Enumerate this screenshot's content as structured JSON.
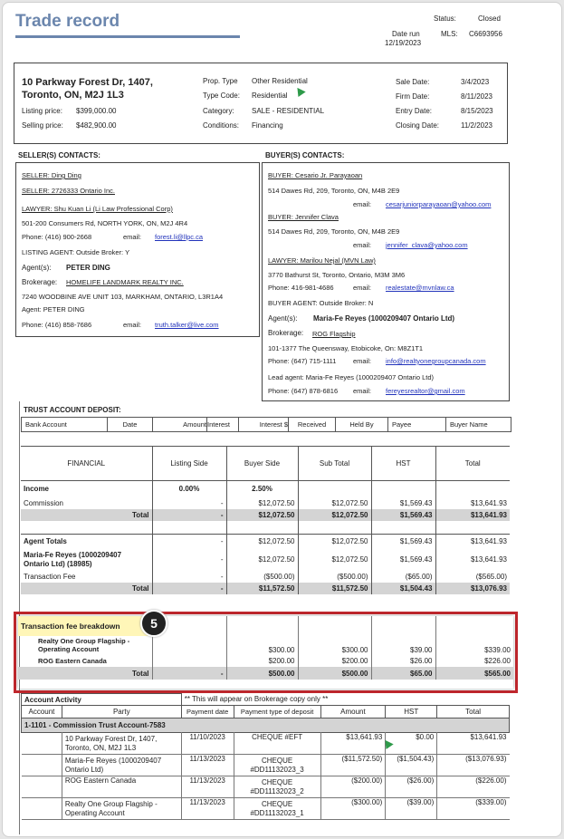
{
  "header": {
    "title": "Trade record",
    "status_label": "Status:",
    "status_value": "Closed",
    "date_run_label": "Date run",
    "date_run_value": "12/19/2023",
    "mls_label": "MLS:",
    "mls_value": "C6693956"
  },
  "property": {
    "address_line1": "10 Parkway Forest Dr, 1407,",
    "address_line2": "Toronto, ON, M2J 1L3",
    "listing_price_label": "Listing price:",
    "listing_price": "$399,000.00",
    "selling_price_label": "Selling price:",
    "selling_price": "$482,900.00",
    "prop_type_label": "Prop. Type",
    "prop_type": "Other Residential",
    "type_code_label": "Type Code:",
    "type_code": "Residential",
    "category_label": "Category:",
    "category": "SALE - RESIDENTIAL",
    "conditions_label": "Conditions:",
    "conditions": "Financing",
    "sale_date_label": "Sale Date:",
    "sale_date": "3/4/2023",
    "firm_date_label": "Firm Date:",
    "firm_date": "8/11/2023",
    "entry_date_label": "Entry Date:",
    "entry_date": "8/15/2023",
    "closing_date_label": "Closing Date:",
    "closing_date": "11/2/2023"
  },
  "sellers": {
    "heading": "SELLER(S) CONTACTS:",
    "seller1": "SELLER: Ding Ding",
    "seller2": "SELLER: 2726333 Ontario Inc.",
    "lawyer": "LAWYER: Shu Kuan  Li (Li Law Professional Corp)",
    "lawyer_address": "501-200 Consumers  Rd, NORTH YORK, ON, M2J 4R4",
    "lawyer_phone": "Phone: (416) 900-2668",
    "email_label": "email:",
    "lawyer_email": "forest.li@llpc.ca",
    "listing_agent": "LISTING AGENT:  Outside Broker: Y",
    "agents_label": "Agent(s):",
    "agent_name": "PETER DING",
    "brokerage_label": "Brokerage:",
    "brokerage": "HOMELIFE LANDMARK REALTY INC.",
    "brokerage_address": "7240 WOODBINE AVE UNIT 103, MARKHAM, ONTARIO, L3R1A4",
    "agent_line": "Agent: PETER DING",
    "agent_phone": "Phone: (416) 858-7686",
    "agent_email": "truth.talker@live.com"
  },
  "buyers": {
    "heading": "BUYER(S) CONTACTS:",
    "buyer1": "BUYER: Cesario Jr. Parayaoan",
    "buyer1_address": "514 Dawes Rd, 209, Toronto, ON, M4B 2E9",
    "buyer1_email": "cesarjuniorparayaoan@yahoo.com",
    "buyer2": "BUYER: Jennifer Clava",
    "buyer2_address": "514 Dawes Rd, 209, Toronto, ON, M4B 2E9",
    "buyer2_email": "jennifer_clava@yahoo.com",
    "email_label": "email:",
    "lawyer": "LAWYER: Marilou Nejal (MVN Law)",
    "lawyer_address": "3770 Bathurst St, Toronto, Ontario, M3M 3M6",
    "lawyer_phone": "Phone: 416-981-4686",
    "lawyer_email": "realestate@mvnlaw.ca",
    "buyer_agent": "BUYER AGENT:  Outside Broker: N",
    "agents_label": "Agent(s):",
    "agent_name": "Maria-Fe Reyes (1000209407 Ontario Ltd)",
    "brokerage_label": "Brokerage:",
    "brokerage": "ROG Flagship",
    "brokerage_address": "101-1377 The Queensway, Etobicoke, On: M8Z1T1",
    "brokerage_phone": "Phone: (647) 715-1111",
    "brokerage_email": "info@realtyonegroupcanada.com",
    "lead_agent": "Lead agent: Maria-Fe Reyes (1000209407 Ontario Ltd)",
    "lead_phone": "Phone: (647) 878-6816",
    "lead_email": "fereyesrealtor@gmail.com"
  },
  "trust": {
    "heading": "TRUST ACCOUNT DEPOSIT:",
    "columns": [
      "Bank Account",
      "Date",
      "Amount",
      "Interest",
      "Interest $",
      "Received",
      "Held By",
      "Payee",
      "Buyer Name"
    ]
  },
  "financial": {
    "columns": [
      "FINANCIAL",
      "Listing Side",
      "Buyer Side",
      "Sub Total",
      "HST",
      "Total"
    ],
    "income_label": "Income",
    "income_listing": "0.00%",
    "income_buyer": "2.50%",
    "commission": [
      "Commission",
      "-",
      "$12,072.50",
      "$12,072.50",
      "$1,569.43",
      "$13,641.93"
    ],
    "total1": [
      "Total",
      "-",
      "$12,072.50",
      "$12,072.50",
      "$1,569.43",
      "$13,641.93"
    ],
    "agent_totals": [
      "Agent Totals",
      "-",
      "$12,072.50",
      "$12,072.50",
      "$1,569.43",
      "$13,641.93"
    ],
    "agent_row_line1": "Maria-Fe Reyes (1000209407",
    "agent_row_line2": "Ontario Ltd) (18985)",
    "agent_row": [
      "-",
      "$12,072.50",
      "$12,072.50",
      "$1,569.43",
      "$13,641.93"
    ],
    "transaction_fee": [
      "Transaction Fee",
      "-",
      "($500.00)",
      "($500.00)",
      "($65.00)",
      "($565.00)"
    ],
    "total2": [
      "Total",
      "-",
      "$11,572.50",
      "$11,572.50",
      "$1,504.43",
      "$13,076.93"
    ]
  },
  "breakdown": {
    "step_badge": "5",
    "title": "Transaction fee breakdown",
    "row1_line1": "Realty One Group Flagship -",
    "row1_line2": "Operating Account",
    "row1": [
      "$300.00",
      "$300.00",
      "$39.00",
      "$339.00"
    ],
    "row2_label": "ROG Eastern Canada",
    "row2": [
      "$200.00",
      "$200.00",
      "$26.00",
      "$226.00"
    ],
    "total": [
      "Total",
      "-",
      "$500.00",
      "$500.00",
      "$65.00",
      "$565.00"
    ]
  },
  "activity": {
    "heading": "Account Activity",
    "note": "** This will appear on Brokerage copy only **",
    "columns": [
      "Account",
      "Party",
      "Payment date",
      "Payment type of deposit",
      "Amount",
      "HST",
      "Total"
    ],
    "group": "1-1101 - Commission Trust Account-7583",
    "rows": [
      {
        "party1": "10 Parkway Forest Dr, 1407,",
        "party2": "Toronto, ON, M2J 1L3",
        "date": "11/10/2023",
        "type1": "CHEQUE #EFT",
        "type2": "",
        "amount": "$13,641.93",
        "hst": "$0.00",
        "total": "$13,641.93"
      },
      {
        "party1": "Maria-Fe Reyes (1000209407",
        "party2": "Ontario Ltd)",
        "date": "11/13/2023",
        "type1": "CHEQUE",
        "type2": "#DD11132023_3",
        "amount": "($11,572.50)",
        "hst": "($1,504.43)",
        "total": "($13,076.93)"
      },
      {
        "party1": "ROG Eastern Canada",
        "party2": "",
        "date": "11/13/2023",
        "type1": "CHEQUE",
        "type2": "#DD11132023_2",
        "amount": "($200.00)",
        "hst": "($26.00)",
        "total": "($226.00)"
      },
      {
        "party1": "Realty One Group Flagship -",
        "party2": "Operating Account",
        "date": "11/13/2023",
        "type1": "CHEQUE",
        "type2": "#DD11132023_1",
        "amount": "($300.00)",
        "hst": "($39.00)",
        "total": "($339.00)"
      }
    ]
  },
  "colors": {
    "title": "#6b86ad",
    "highlight_border": "#c0272d",
    "badge_bg": "#222222",
    "breakdown_title_bg": "#fff6b8",
    "cursor": "#2e9a4a"
  },
  "icons": [
    "mouse-cursor-icon"
  ]
}
